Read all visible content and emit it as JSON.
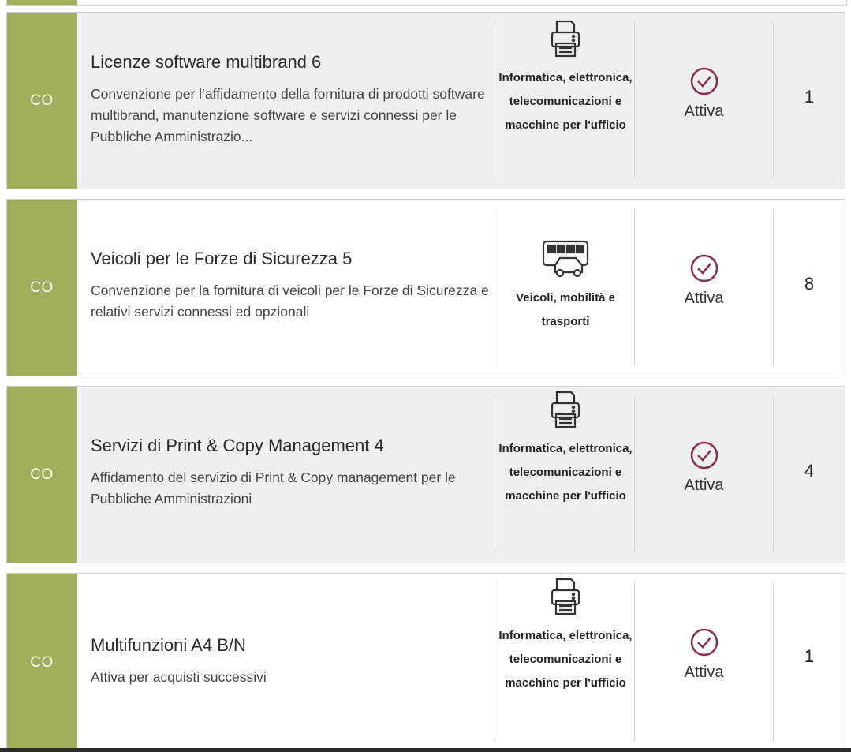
{
  "colors": {
    "accent": "#9eb15a",
    "status_icon": "#8b2c54",
    "card_grey": "#efefef"
  },
  "cards": [
    {
      "tag": "CO",
      "title": "Licenze software multibrand 6",
      "description": "Convenzione per l’affidamento della fornitura di prodotti software multibrand, manutenzione software e servizi connessi per le Pubbliche Amministrazio...",
      "category_icon": "printer-icon",
      "category": "Informatica, elettronica, telecomunicazioni e macchine per l'ufficio",
      "status": "Attiva",
      "status_icon": "check-circle-icon",
      "count": "1"
    },
    {
      "tag": "CO",
      "title": "Veicoli per le Forze di Sicurezza 5",
      "description": "Convenzione per la fornitura di veicoli per le Forze di Sicurezza e relativi servizi connessi ed opzionali",
      "category_icon": "vehicles-icon",
      "category": "Veicoli, mobilità e trasporti",
      "status": "Attiva",
      "status_icon": "check-circle-icon",
      "count": "8"
    },
    {
      "tag": "CO",
      "title": "Servizi di Print & Copy Management 4",
      "description": "Affidamento del servizio di Print & Copy management per le Pubbliche Amministrazioni",
      "category_icon": "printer-icon",
      "category": "Informatica, elettronica, telecomunicazioni e macchine per l'ufficio",
      "status": "Attiva",
      "status_icon": "check-circle-icon",
      "count": "4"
    },
    {
      "tag": "CO",
      "title": "Multifunzioni A4 B/N",
      "description": "Attiva per acquisti successivi",
      "category_icon": "printer-icon",
      "category": "Informatica, elettronica, telecomunicazioni e macchine per l'ufficio",
      "status": "Attiva",
      "status_icon": "check-circle-icon",
      "count": "1"
    }
  ]
}
